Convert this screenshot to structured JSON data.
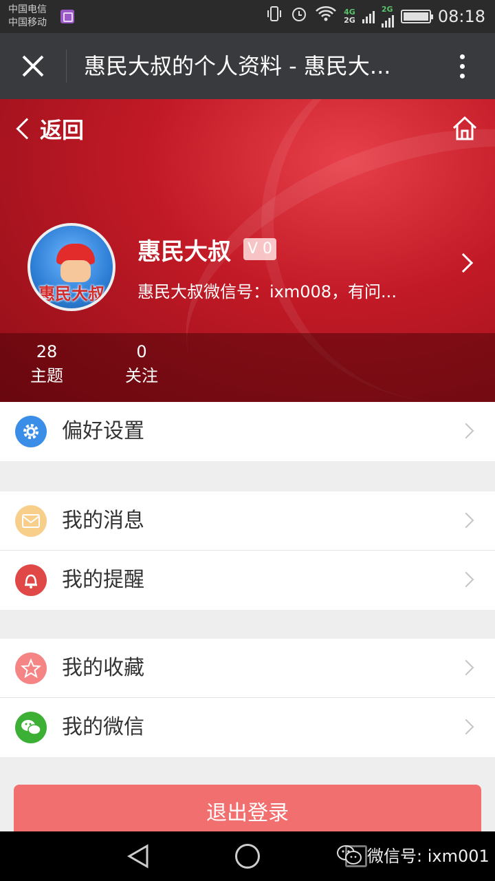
{
  "status_bar": {
    "carrier_1": "中国电信",
    "carrier_2": "中国移动",
    "net_top": "4G",
    "net_bottom": "2G",
    "net_2": "2G",
    "time": "08:18"
  },
  "title_bar": {
    "title": "惠民大叔的个人资料 - 惠民大..."
  },
  "profile": {
    "back_label": "返回",
    "name": "惠民大叔",
    "level_badge": "V 0",
    "description": "惠民大叔微信号：ixm008，有问...",
    "avatar_text": "惠民大叔",
    "stats": [
      {
        "value": "28",
        "label": "主题"
      },
      {
        "value": "0",
        "label": "关注"
      }
    ],
    "colors": {
      "header": "#c21a26"
    }
  },
  "menu": {
    "preferences": {
      "label": "偏好设置",
      "icon": "gear-icon",
      "color": "#3b8ee8"
    },
    "messages": {
      "label": "我的消息",
      "icon": "envelope-icon",
      "color": "#f5c77e"
    },
    "reminders": {
      "label": "我的提醒",
      "icon": "bell-icon",
      "color": "#e04848"
    },
    "favorites": {
      "label": "我的收藏",
      "icon": "star-icon",
      "color": "#f57c7c"
    },
    "wechat": {
      "label": "我的微信",
      "icon": "wechat-icon",
      "color": "#3cb034"
    }
  },
  "logout_label": "退出登录",
  "watermark": "微信号: ixm001"
}
